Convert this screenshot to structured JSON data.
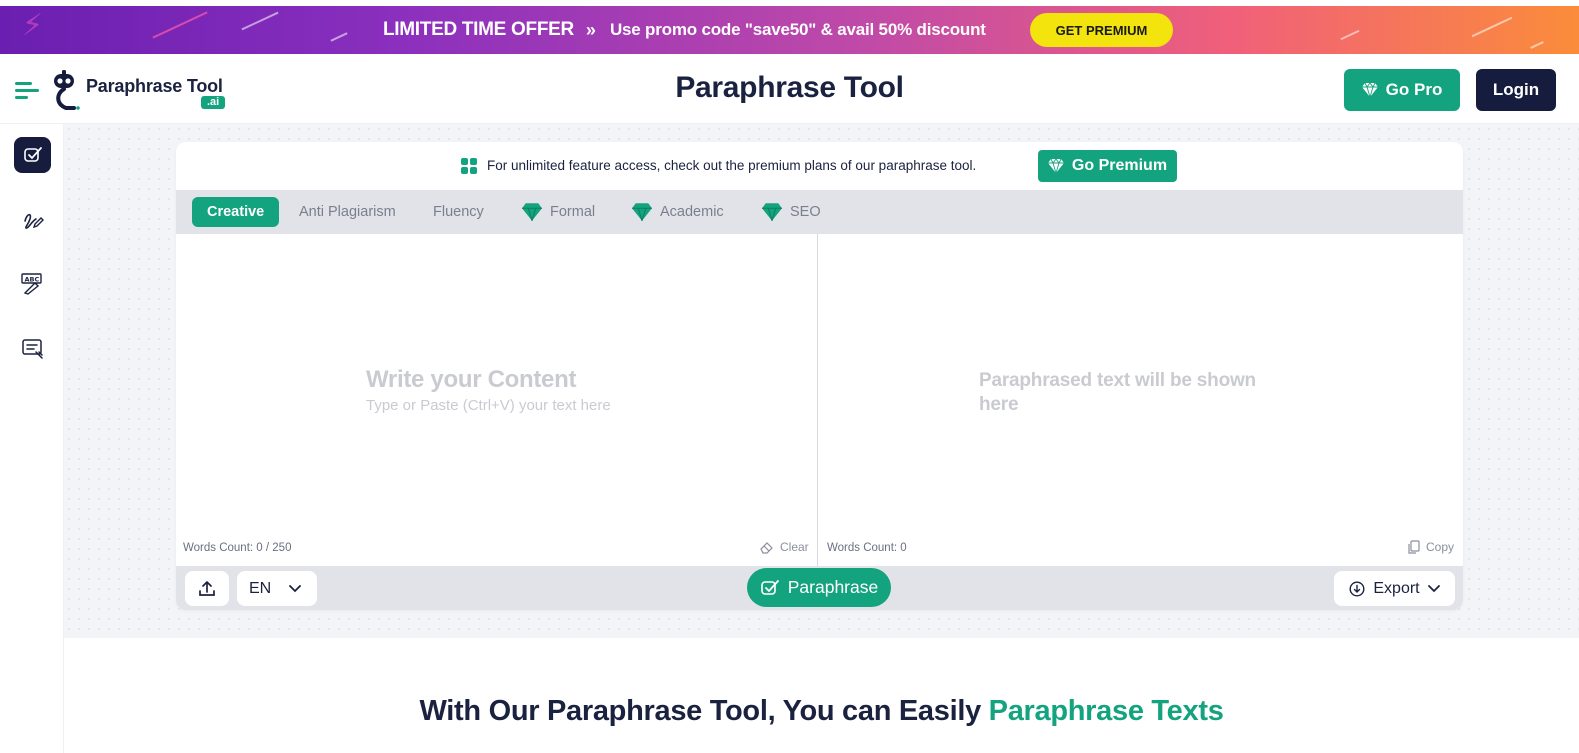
{
  "promo": {
    "title": "LIMITED TIME OFFER",
    "chevron": "»",
    "text": "Use promo code \"save50\" & avail 50% discount",
    "button": "GET PREMIUM"
  },
  "header": {
    "logo_text": "Paraphrase Tool",
    "logo_badge": ".ai",
    "title": "Paraphrase Tool",
    "go_pro": "Go Pro",
    "login": "Login"
  },
  "sidebar": {
    "items": [
      {
        "icon": "paraphrase-tool-icon",
        "active": true
      },
      {
        "icon": "signature-icon",
        "active": false
      },
      {
        "icon": "grammar-check-icon",
        "active": false
      },
      {
        "icon": "summarizer-icon",
        "active": false
      }
    ]
  },
  "notice": {
    "text": "For unlimited feature access, check out the premium plans of our paraphrase tool.",
    "button": "Go Premium"
  },
  "tabs": [
    {
      "label": "Creative",
      "active": true,
      "premium": false
    },
    {
      "label": "Anti Plagiarism",
      "active": false,
      "premium": false
    },
    {
      "label": "Fluency",
      "active": false,
      "premium": false
    },
    {
      "label": "Formal",
      "active": false,
      "premium": true
    },
    {
      "label": "Academic",
      "active": false,
      "premium": true
    },
    {
      "label": "SEO",
      "active": false,
      "premium": true
    }
  ],
  "input_pane": {
    "placeholder_title": "Write your Content",
    "placeholder_sub": "Type or Paste (Ctrl+V) your text here",
    "words_count": "Words Count: 0 / 250",
    "clear": "Clear"
  },
  "output_pane": {
    "placeholder": "Paraphrased text will be shown here",
    "words_count": "Words Count: 0",
    "copy": "Copy"
  },
  "bottom": {
    "language": "EN",
    "paraphrase": "Paraphrase",
    "export": "Export"
  },
  "section": {
    "heading_main": "With Our Paraphrase Tool, You can Easily ",
    "heading_accent": "Paraphrase Texts"
  },
  "colors": {
    "accent": "#14a37f",
    "navy": "#161c3d",
    "promo_button": "#f2e40c"
  }
}
